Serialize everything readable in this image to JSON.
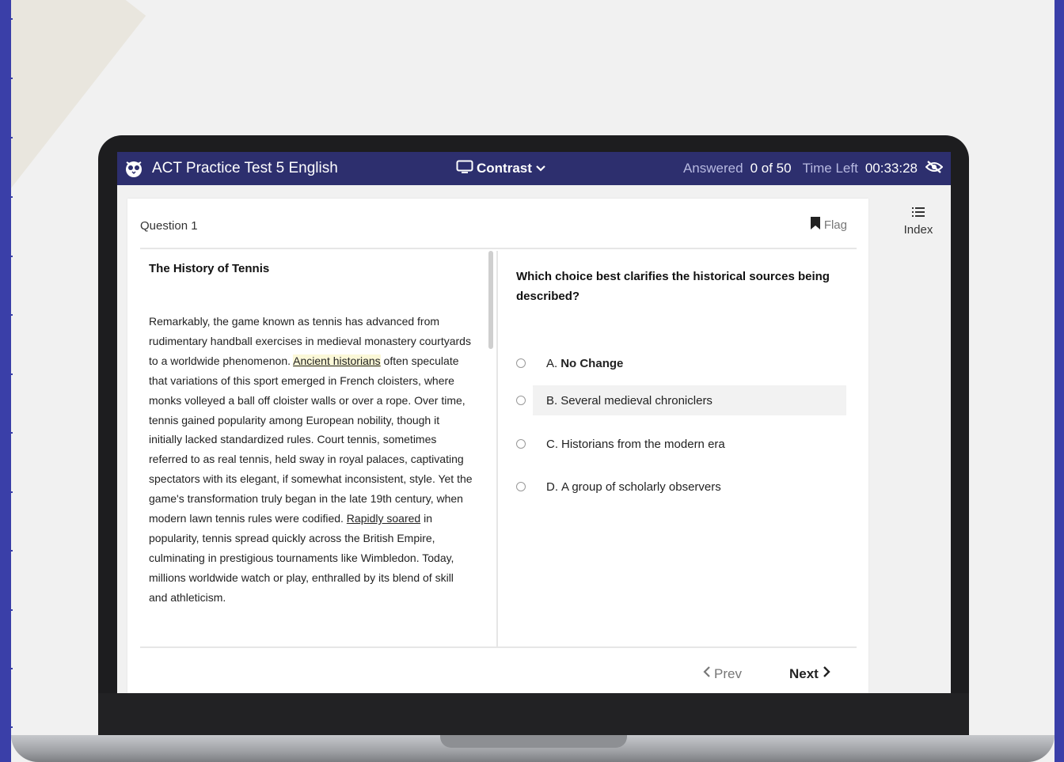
{
  "app": {
    "title": "ACT Practice Test 5 English",
    "contrast_label": "Contrast",
    "answered_label": "Answered",
    "answered_value": "0 of 50",
    "time_label": "Time Left",
    "time_value": "00:33:28"
  },
  "question": {
    "number_label": "Question 1",
    "flag_label": "Flag",
    "prompt": "Which choice best clarifies the historical sources being described?",
    "options": [
      {
        "letter": "A.",
        "text": "No Change"
      },
      {
        "letter": "B.",
        "text": "Several medieval chroniclers"
      },
      {
        "letter": "C.",
        "text": "Historians from the modern era"
      },
      {
        "letter": "D.",
        "text": "A group of scholarly observers"
      }
    ]
  },
  "passage": {
    "title": "The History of Tennis",
    "text_before": "Remarkably, the game known as tennis has advanced from rudimentary handball exercises in medieval monastery courtyards to a worldwide phenomenon.",
    "highlight": "Ancient historians",
    "text_middle": "often speculate that variations of this sport emerged in French cloisters, where monks volleyed a ball off cloister walls or over a rope. Over time, tennis gained popularity among European nobility, though it initially lacked standardized rules. Court tennis, sometimes referred to as real tennis, held sway in royal palaces, captivating spectators with its elegant, if somewhat inconsistent, style. Yet the game's transformation truly began in the late 19th century, when modern lawn tennis rules were codified.",
    "underline": "Rapidly soared",
    "text_after": "in popularity, tennis spread quickly across the British Empire, culminating in prestigious tournaments like Wimbledon. Today, millions worldwide watch or play, enthralled by its blend of skill and athleticism."
  },
  "nav": {
    "prev_label": "Prev",
    "next_label": "Next",
    "index_label": "Index"
  },
  "colors": {
    "header_bg": "#2d2f6e",
    "page_border": "#3a3fa8",
    "highlight_bg": "#fbf8d8"
  }
}
